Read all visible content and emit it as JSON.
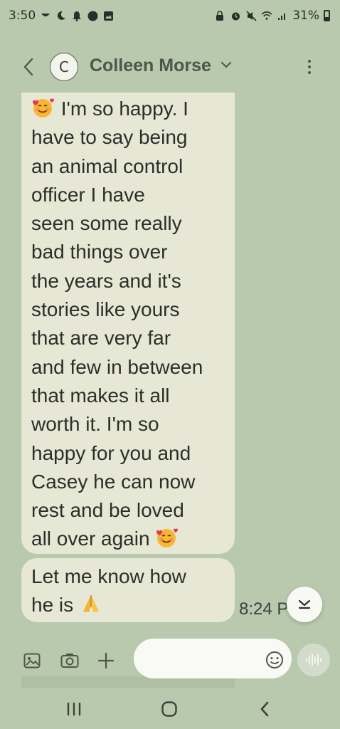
{
  "status_bar": {
    "time": "3:50",
    "battery": "31%"
  },
  "header": {
    "avatar_initial": "C",
    "contact_name": "Colleen Morse"
  },
  "messages": [
    {
      "lines": [
        "I'm so happy. I",
        "have to say being",
        "an animal control",
        "officer I have",
        "seen some really",
        "bad things over",
        "the years and it's",
        "stories like yours",
        "that are very far",
        "and few in between",
        "that makes it all",
        "worth it. I'm so",
        "happy for you and",
        "Casey he can now",
        "rest and be loved",
        "all over again"
      ]
    },
    {
      "lines": [
        "Let me know how",
        "he is"
      ],
      "time": "8:24 P"
    }
  ],
  "composer": {
    "placeholder": ""
  },
  "colors": {
    "background": "#b8c9ad",
    "bubble": "#e6e8d5",
    "input": "#f9f9f5"
  },
  "icons": {
    "back": "back-arrow-icon",
    "more": "more-vertical-icon",
    "scroll_down": "chevron-down-icon",
    "gallery": "gallery-icon",
    "camera": "camera-icon",
    "add": "plus-icon",
    "emoji": "emoji-icon",
    "voice": "voice-wave-icon"
  }
}
